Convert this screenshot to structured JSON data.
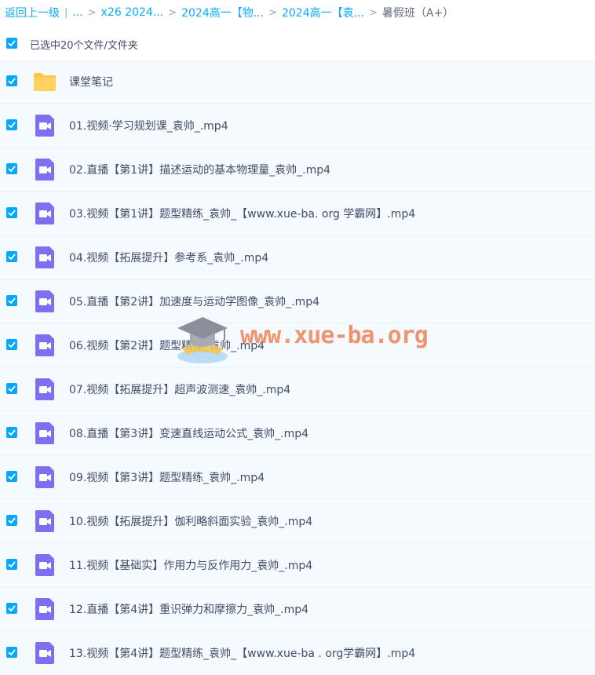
{
  "breadcrumb": {
    "back": "返回上一级",
    "ellipsis": "...",
    "crumbs": [
      "x26 2024...",
      "2024高一【物...",
      "2024高一【袁..."
    ],
    "current": "暑假班（A+）"
  },
  "selection": {
    "label": "已选中20个文件/文件夹"
  },
  "files": [
    {
      "name": "课堂笔记",
      "type": "folder-icon"
    },
    {
      "name": "01.视频·学习规划课_袁帅_.mp4",
      "type": "video-file-icon"
    },
    {
      "name": "02.直播【第1讲】描述运动的基本物理量_袁帅_.mp4",
      "type": "video-file-icon"
    },
    {
      "name": "03.视频【第1讲】题型精练_袁帅_【www.xue-ba. org 学霸网】.mp4",
      "type": "video-file-icon"
    },
    {
      "name": "04.视频【拓展提升】参考系_袁帅_.mp4",
      "type": "video-file-icon"
    },
    {
      "name": "05.直播【第2讲】加速度与运动学图像_袁帅_.mp4",
      "type": "video-file-icon"
    },
    {
      "name": "06.视频【第2讲】题型精练_袁帅_.mp4",
      "type": "video-file-icon"
    },
    {
      "name": "07.视频【拓展提升】超声波测速_袁帅_.mp4",
      "type": "video-file-icon"
    },
    {
      "name": "08.直播【第3讲】变速直线运动公式_袁帅_.mp4",
      "type": "video-file-icon"
    },
    {
      "name": "09.视频【第3讲】题型精练_袁帅_.mp4",
      "type": "video-file-icon"
    },
    {
      "name": "10.视频【拓展提升】伽利略斜面实验_袁帅_.mp4",
      "type": "video-file-icon"
    },
    {
      "name": "11.视频【基础实】作用力与反作用力_袁帅_.mp4",
      "type": "video-file-icon"
    },
    {
      "name": "12.直播【第4讲】重识弹力和摩擦力_袁帅_.mp4",
      "type": "video-file-icon"
    },
    {
      "name": "13.视频【第4讲】题型精练_袁帅_【www.xue-ba . org学霸网】.mp4",
      "type": "video-file-icon"
    }
  ],
  "watermark": {
    "text": "www.xue-ba.org"
  },
  "colors": {
    "accent": "#06a7ff",
    "video_icon": "#7c6ff0",
    "folder": "#ffc745"
  }
}
